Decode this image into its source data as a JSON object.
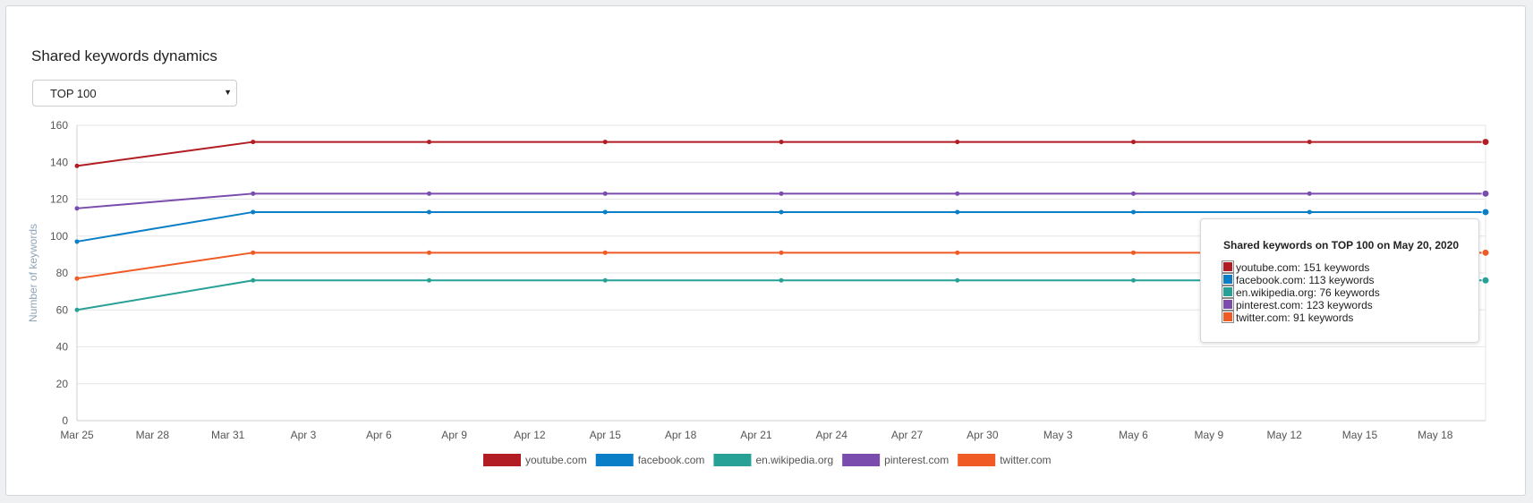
{
  "title": "Shared keywords dynamics",
  "select": {
    "value": "TOP 100"
  },
  "tooltip": {
    "title": "Shared keywords on TOP 100 on May 20, 2020",
    "rows": [
      {
        "label": "youtube.com: 151 keywords",
        "color": "#b21d24"
      },
      {
        "label": "facebook.com: 113 keywords",
        "color": "#0a7fc7"
      },
      {
        "label": "en.wikipedia.org: 76 keywords",
        "color": "#27a195"
      },
      {
        "label": "pinterest.com: 123 keywords",
        "color": "#7a4cad"
      },
      {
        "label": "twitter.com: 91 keywords",
        "color": "#f05a24"
      }
    ]
  },
  "chart_data": {
    "type": "line",
    "ylabel": "Number of keywords",
    "ylim": [
      0,
      160
    ],
    "yticks": [
      0,
      20,
      40,
      60,
      80,
      100,
      120,
      140,
      160
    ],
    "xtick_labels": [
      "Mar 25",
      "Mar 28",
      "Mar 31",
      "Apr 3",
      "Apr 6",
      "Apr 9",
      "Apr 12",
      "Apr 15",
      "Apr 18",
      "Apr 21",
      "Apr 24",
      "Apr 27",
      "Apr 30",
      "May 3",
      "May 6",
      "May 9",
      "May 12",
      "May 15",
      "May 18"
    ],
    "x": [
      "Mar 25",
      "Apr 1",
      "Apr 8",
      "Apr 15",
      "Apr 22",
      "Apr 29",
      "May 6",
      "May 13",
      "May 20"
    ],
    "series": [
      {
        "name": "youtube.com",
        "color": "#b21d24",
        "values": [
          138,
          151,
          151,
          151,
          151,
          151,
          151,
          151,
          151
        ]
      },
      {
        "name": "facebook.com",
        "color": "#0a7fc7",
        "values": [
          97,
          113,
          113,
          113,
          113,
          113,
          113,
          113,
          113
        ]
      },
      {
        "name": "en.wikipedia.org",
        "color": "#27a195",
        "values": [
          60,
          76,
          76,
          76,
          76,
          76,
          76,
          76,
          76
        ]
      },
      {
        "name": "pinterest.com",
        "color": "#7a4cad",
        "values": [
          115,
          123,
          123,
          123,
          123,
          123,
          123,
          123,
          123
        ]
      },
      {
        "name": "twitter.com",
        "color": "#f05a24",
        "values": [
          77,
          91,
          91,
          91,
          91,
          91,
          91,
          91,
          91
        ]
      }
    ],
    "legend_position": "bottom"
  }
}
